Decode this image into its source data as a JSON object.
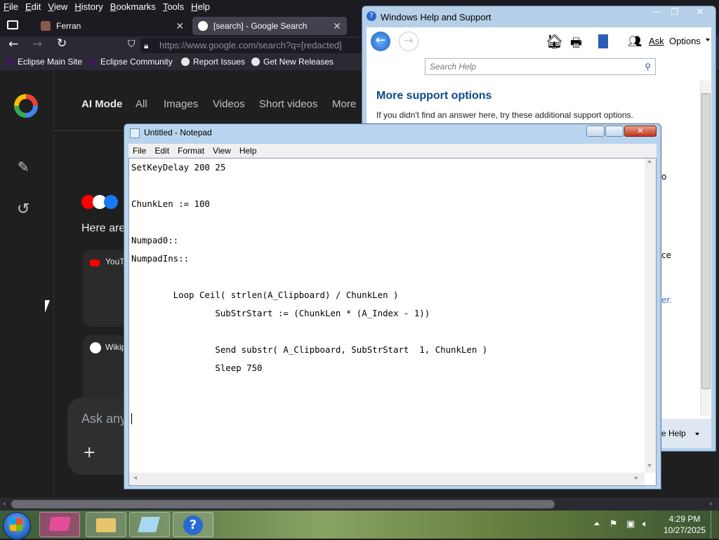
{
  "browser": {
    "menu": [
      "File",
      "Edit",
      "View",
      "History",
      "Bookmarks",
      "Tools",
      "Help"
    ],
    "tabs": [
      {
        "title": "Ferran"
      },
      {
        "title": "[search] - Google Search"
      }
    ],
    "url": "https://www.google.com/search?q=[redacted]",
    "bookmarks": [
      "Eclipse Main Site",
      "Eclipse Community",
      "Report Issues",
      "Get New Releases"
    ]
  },
  "google": {
    "nav": [
      "AI Mode",
      "All",
      "Images",
      "Videos",
      "Short videos",
      "More"
    ],
    "results_intro": "Here are",
    "card1_source": "YouTu",
    "card2_source": "Wikip",
    "ask_placeholder": "Ask any",
    "plus": "+"
  },
  "help": {
    "title": "Windows Help and Support",
    "toolbar_ask": "Ask",
    "toolbar_options": "Options",
    "search_placeholder": "Search Help",
    "heading": "More support options",
    "subtext": "If you didn't find an answer here, try these additional support options.",
    "bottom_help": "e Help",
    "right_snips": [
      "o",
      "ce",
      "er."
    ]
  },
  "notepad": {
    "title": "Untitled - Notepad",
    "menu": [
      "File",
      "Edit",
      "Format",
      "View",
      "Help"
    ],
    "content": "SetKeyDelay 200 25\n\nChunkLen := 100\n\nNumpad0::\nNumpadIns::\n\n        Loop Ceil( strlen(A_Clipboard) / ChunkLen )\n                SubStrStart := (ChunkLen * (A_Index - 1))\n\n                Send substr( A_Clipboard, SubStrStart  1, ChunkLen )\n                Sleep 750\n\n\n"
  },
  "taskbar": {
    "time": "4:29 PM",
    "date": "10/27/2025"
  },
  "colors": {
    "help_heading": "#0b4a8b",
    "link_blue": "#8ab4f8"
  }
}
